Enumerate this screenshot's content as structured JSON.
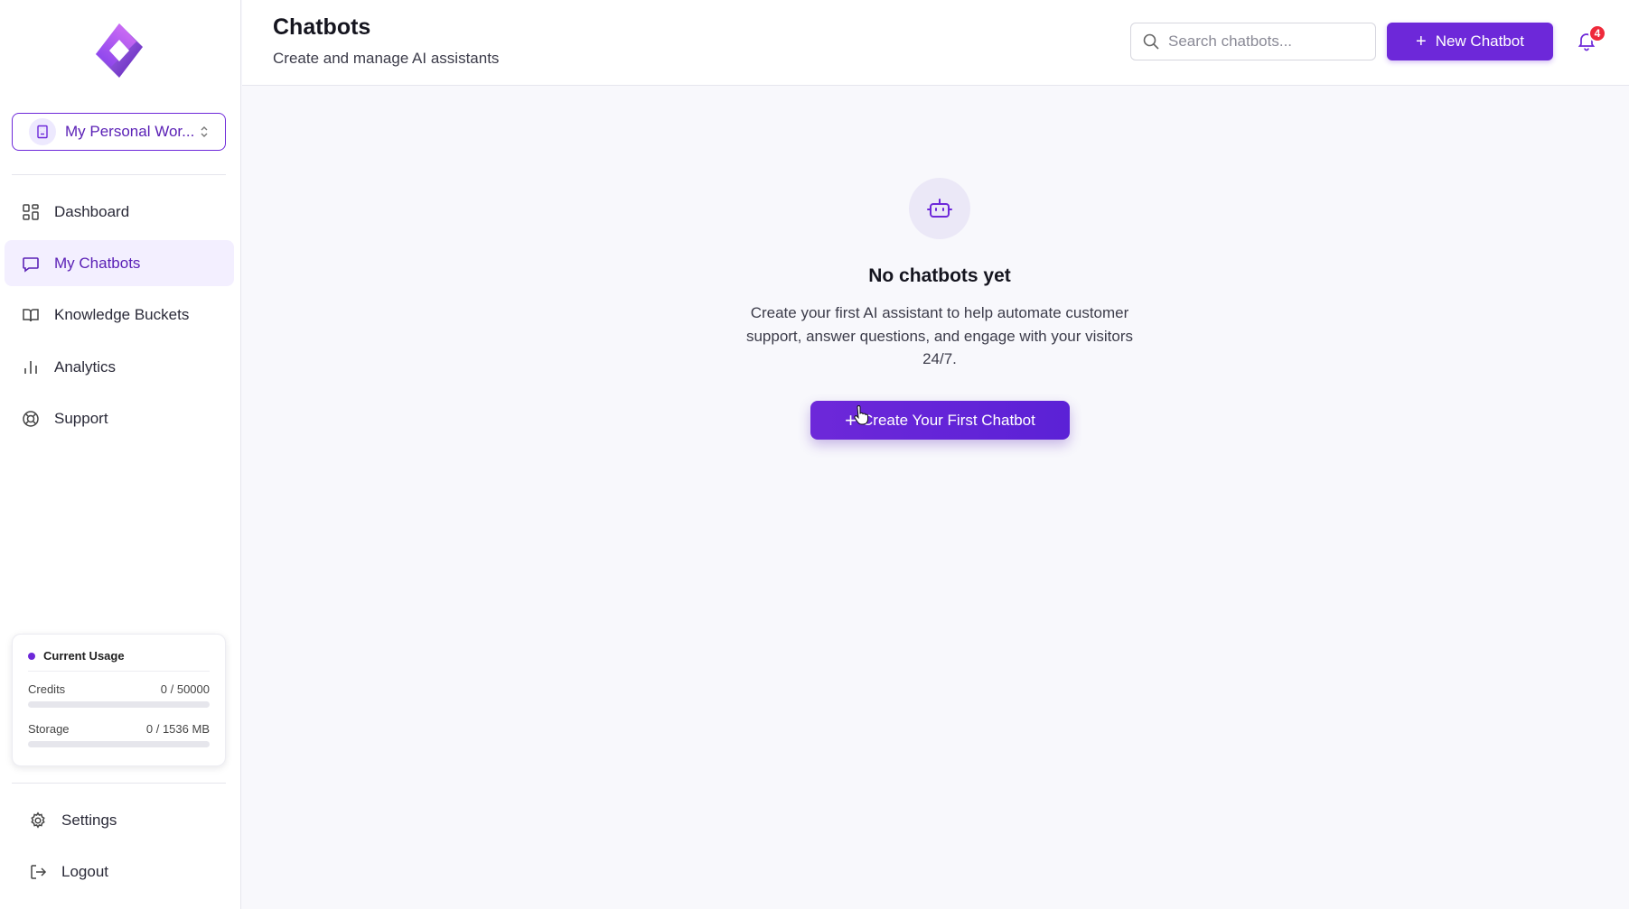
{
  "sidebar": {
    "logo_icon": "app-logo-icon",
    "workspace": {
      "label": "My Personal Wor...",
      "icon": "building-icon",
      "chevron": "chevron-up-down-icon"
    },
    "nav": [
      {
        "label": "Dashboard",
        "icon": "grid-icon",
        "active": false
      },
      {
        "label": "My Chatbots",
        "icon": "chat-bubble-icon",
        "active": true
      },
      {
        "label": "Knowledge Buckets",
        "icon": "book-icon",
        "active": false
      },
      {
        "label": "Analytics",
        "icon": "bar-chart-icon",
        "active": false
      },
      {
        "label": "Support",
        "icon": "lifebuoy-icon",
        "active": false
      }
    ],
    "usage": {
      "title": "Current Usage",
      "credits_label": "Credits",
      "credits_value": "0 / 50000",
      "credits_fraction": 0,
      "storage_label": "Storage",
      "storage_value": "0 / 1536 MB",
      "storage_fraction": 0
    },
    "footer": [
      {
        "label": "Settings",
        "icon": "gear-icon"
      },
      {
        "label": "Logout",
        "icon": "logout-icon"
      }
    ]
  },
  "header": {
    "title": "Chatbots",
    "subtitle": "Create and manage AI assistants",
    "search_placeholder": "Search chatbots...",
    "new_button_label": "New Chatbot",
    "notification_count": "4"
  },
  "empty_state": {
    "icon": "robot-icon",
    "title": "No chatbots yet",
    "description": "Create your first AI assistant to help automate customer support, answer questions, and engage with your visitors 24/7.",
    "button_label": "Create Your First Chatbot"
  },
  "colors": {
    "accent": "#6d28d9",
    "accent_light": "#f3efff",
    "badge": "#ef2a3b",
    "background": "#f8f8fc"
  }
}
